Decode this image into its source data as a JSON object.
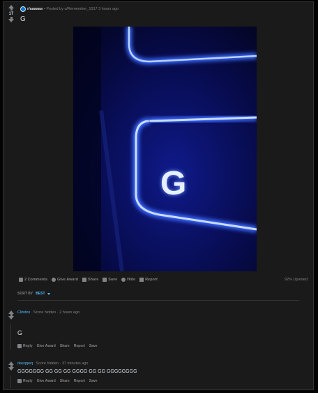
{
  "post": {
    "votes": "17",
    "subreddit": "r/aaaaaa",
    "posted_by": "• Posted by u/Remember_1017 3 hours ago",
    "title": "G"
  },
  "actions": {
    "comments": "2 Comments",
    "award": "Give Award",
    "share": "Share",
    "save": "Save",
    "hide": "Hide",
    "report": "Report",
    "upvoted": "92% Upvoted"
  },
  "sort": {
    "label": "SORT BY",
    "value": "BEST"
  },
  "comments": [
    {
      "author": "Clindox",
      "score": "Score hidden",
      "time": "· 2 hours ago",
      "body": "G",
      "reply": "Reply",
      "award": "Give Award",
      "share": "Share",
      "report": "Report",
      "save": "Save"
    },
    {
      "author": "dasqqwq",
      "score": "Score hidden",
      "time": "· 37 minutes ago",
      "body": "GGGGGGG GG GG GG GGGG GG GG GGGGGGGG",
      "reply": "Reply",
      "award": "Give Award",
      "share": "Share",
      "report": "Report",
      "save": "Save"
    }
  ],
  "image": {
    "key_letter": "G"
  },
  "colors": {
    "accent": "#4fbcff",
    "background": "#1a1a1b",
    "image_glow": "#2a4dff"
  }
}
